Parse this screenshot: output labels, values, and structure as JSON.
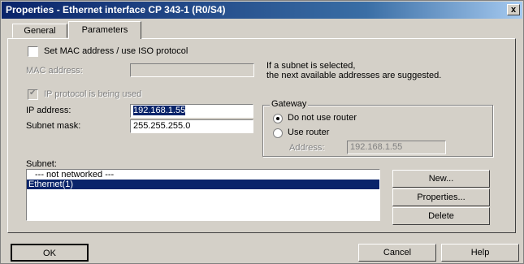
{
  "window": {
    "title": "Properties - Ethernet interface  CP 343-1 (R0/S4)",
    "close_symbol": "x"
  },
  "tabs": [
    {
      "label": "General"
    },
    {
      "label": "Parameters"
    }
  ],
  "mac": {
    "checkbox_label": "Set MAC address / use ISO protocol",
    "address_label": "MAC address:",
    "address_value": ""
  },
  "hint": {
    "line1": "If a subnet is selected,",
    "line2": "the next available addresses are suggested."
  },
  "ip_protocol": {
    "label": "IP protocol is being used"
  },
  "ip": {
    "address_label": "IP address:",
    "address_value": "192.168.1.55",
    "mask_label": "Subnet mask:",
    "mask_value": "255.255.255.0"
  },
  "gateway": {
    "title": "Gateway",
    "option1": "Do not use router",
    "option2": "Use router",
    "address_label": "Address:",
    "address_value": "192.168.1.55"
  },
  "subnet": {
    "label": "Subnet:",
    "items": [
      {
        "label": "--- not networked ---"
      },
      {
        "label": "Ethernet(1)"
      }
    ]
  },
  "side_buttons": {
    "new": "New...",
    "properties": "Properties...",
    "delete": "Delete"
  },
  "footer": {
    "ok": "OK",
    "cancel": "Cancel",
    "help": "Help"
  }
}
